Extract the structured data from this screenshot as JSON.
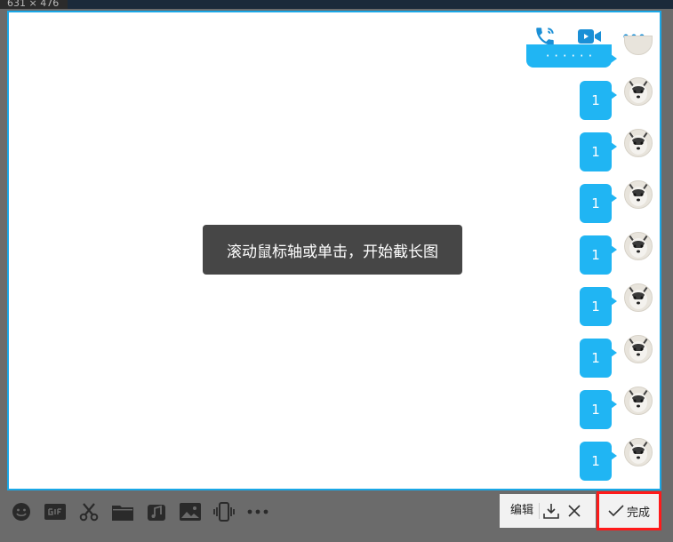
{
  "size_label": "631 × 476",
  "toast": {
    "text": "滚动鼠标轴或单击，开始截长图"
  },
  "partial_message": {
    "text": "· · · · · ·"
  },
  "messages": [
    {
      "text": "1"
    },
    {
      "text": "1"
    },
    {
      "text": "1"
    },
    {
      "text": "1"
    },
    {
      "text": "1"
    },
    {
      "text": "1"
    },
    {
      "text": "1"
    },
    {
      "text": "1"
    }
  ],
  "header_icons": [
    "phone-icon",
    "video-call-icon",
    "more-icon"
  ],
  "toolbar_icons": [
    "emoji-icon",
    "gif-icon",
    "scissors-icon",
    "folder-icon",
    "music-icon",
    "image-icon",
    "shake-icon",
    "more-icon"
  ],
  "actions": {
    "edit_label": "编辑",
    "done_label": "完成"
  },
  "colors": {
    "accent": "#20b5f3",
    "highlight": "#ff1a1a",
    "frame": "#1aa7e6"
  }
}
